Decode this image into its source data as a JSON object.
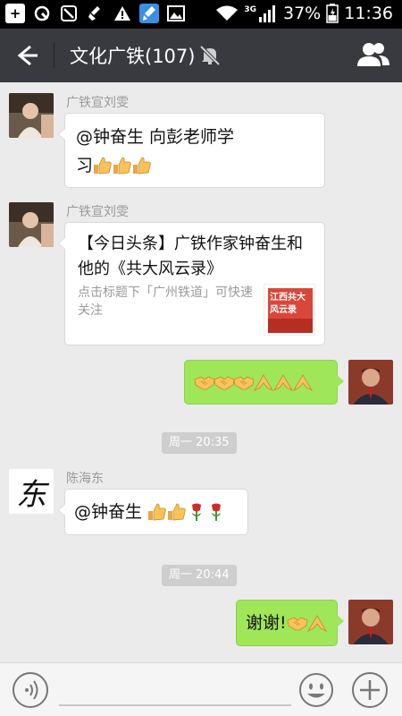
{
  "status_bar": {
    "network": "3G",
    "battery": "37%",
    "time": "11:36"
  },
  "chat": {
    "title": "文化广铁(107)",
    "muted": true
  },
  "messages": [
    {
      "sender": "广铁宣刘雯",
      "line1": "@钟奋生 向彭老师学",
      "line2": "习",
      "emojis": [
        "thumbs-up",
        "thumbs-up",
        "thumbs-up"
      ]
    },
    {
      "sender": "广铁宣刘雯",
      "card_title": "【今日头条】广铁作家钟奋生和他的《共大风云录》",
      "card_desc": "点击标题下「广州铁道」可快速关注",
      "thumb_text_1": "江西共大",
      "thumb_text_2": "风云录"
    },
    {
      "self": true,
      "emojis": [
        "handshake",
        "handshake",
        "handshake",
        "clap",
        "clap",
        "clap"
      ]
    },
    {
      "time": "周一 20:35"
    },
    {
      "sender": "陈海东",
      "text": "@钟奋生 ",
      "emojis": [
        "thumbs-up",
        "thumbs-up",
        "rose",
        "rose"
      ],
      "avatar_char": "东"
    },
    {
      "time": "周一 20:44"
    },
    {
      "self": true,
      "text": "谢谢!",
      "emojis": [
        "handshake",
        "clap"
      ]
    }
  ],
  "colors": {
    "titlebar": "#393a3f",
    "self_bubble": "#9fe658",
    "background": "#ebebeb"
  },
  "input": {
    "value": ""
  }
}
